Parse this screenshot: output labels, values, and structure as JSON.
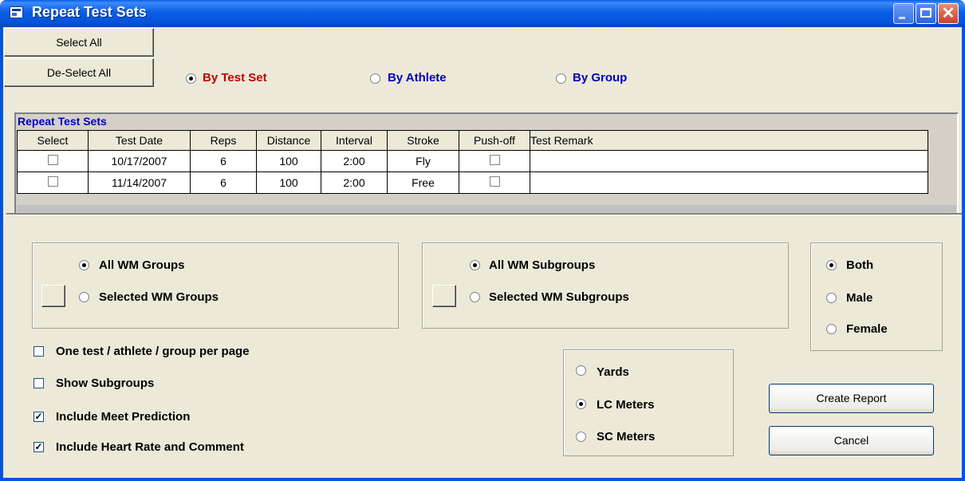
{
  "window": {
    "title": "Repeat Test Sets"
  },
  "buttons": {
    "select_all": "Select All",
    "deselect_all": "De-Select All",
    "create_report": "Create Report",
    "cancel": "Cancel"
  },
  "mode": {
    "options": [
      "By Test Set",
      "By Athlete",
      "By Group"
    ],
    "selected": "By Test Set"
  },
  "grid": {
    "caption": "Repeat Test Sets",
    "columns": [
      "Select",
      "Test Date",
      "Reps",
      "Distance",
      "Interval",
      "Stroke",
      "Push-off",
      "Test Remark"
    ],
    "rows": [
      {
        "select": false,
        "test_date": "10/17/2007",
        "reps": "6",
        "distance": "100",
        "interval": "2:00",
        "stroke": "Fly",
        "push_off": false,
        "remark": ""
      },
      {
        "select": false,
        "test_date": "11/14/2007",
        "reps": "6",
        "distance": "100",
        "interval": "2:00",
        "stroke": "Free",
        "push_off": false,
        "remark": ""
      }
    ]
  },
  "groups": {
    "all": "All WM Groups",
    "selected": "Selected WM Groups",
    "value": "All WM Groups"
  },
  "subgroups": {
    "all": "All WM Subgroups",
    "selected": "Selected WM Subgroups",
    "value": "All WM Subgroups"
  },
  "gender": {
    "options": [
      "Both",
      "Male",
      "Female"
    ],
    "selected": "Both"
  },
  "options": {
    "one_per_page": {
      "label": "One test / athlete / group per page",
      "checked": false
    },
    "show_subgroups": {
      "label": "Show Subgroups",
      "checked": false
    },
    "meet_prediction": {
      "label": "Include Meet Prediction",
      "checked": true
    },
    "heart_rate": {
      "label": "Include Heart Rate and Comment",
      "checked": true
    }
  },
  "units": {
    "options": [
      "Yards",
      "LC Meters",
      "SC Meters"
    ],
    "selected": "LC Meters"
  }
}
